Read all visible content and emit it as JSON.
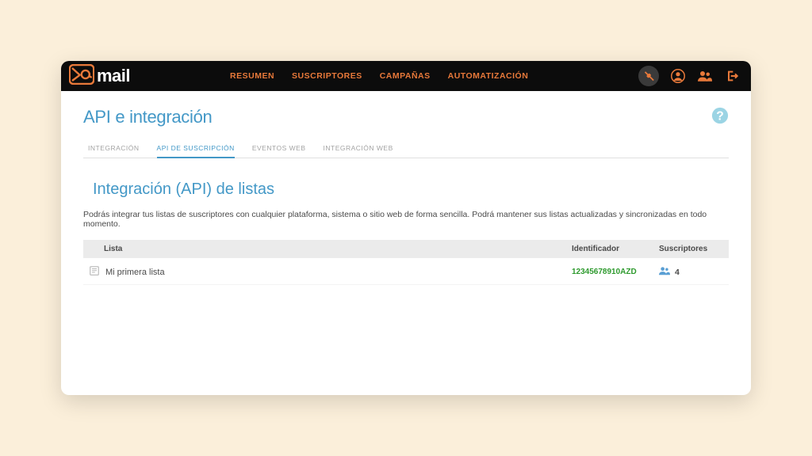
{
  "brand": {
    "name": "mail"
  },
  "nav": {
    "items": [
      {
        "label": "RESUMEN"
      },
      {
        "label": "SUSCRIPTORES"
      },
      {
        "label": "CAMPAÑAS"
      },
      {
        "label": "AUTOMATIZACIÓN"
      }
    ]
  },
  "page": {
    "title": "API e integración"
  },
  "tabs": {
    "items": [
      {
        "label": "INTEGRACIÓN",
        "active": false
      },
      {
        "label": "API DE SUSCRIPCIÓN",
        "active": true
      },
      {
        "label": "EVENTOS WEB",
        "active": false
      },
      {
        "label": "INTEGRACIÓN WEB",
        "active": false
      }
    ]
  },
  "section": {
    "title": "Integración (API) de listas",
    "description": "Podrás integrar tus listas de suscriptores con cualquier plataforma, sistema o sitio web de forma sencilla. Podrá mantener sus listas actualizadas y sincronizadas en todo momento."
  },
  "table": {
    "headers": {
      "lista": "Lista",
      "identificador": "Identificador",
      "suscriptores": "Suscriptores"
    },
    "rows": [
      {
        "lista": "Mi primera lista",
        "identificador": "12345678910AZD",
        "suscriptores": "4"
      }
    ]
  },
  "colors": {
    "accent": "#e8793a",
    "blue": "#4398c7",
    "green": "#2e9a2e"
  }
}
